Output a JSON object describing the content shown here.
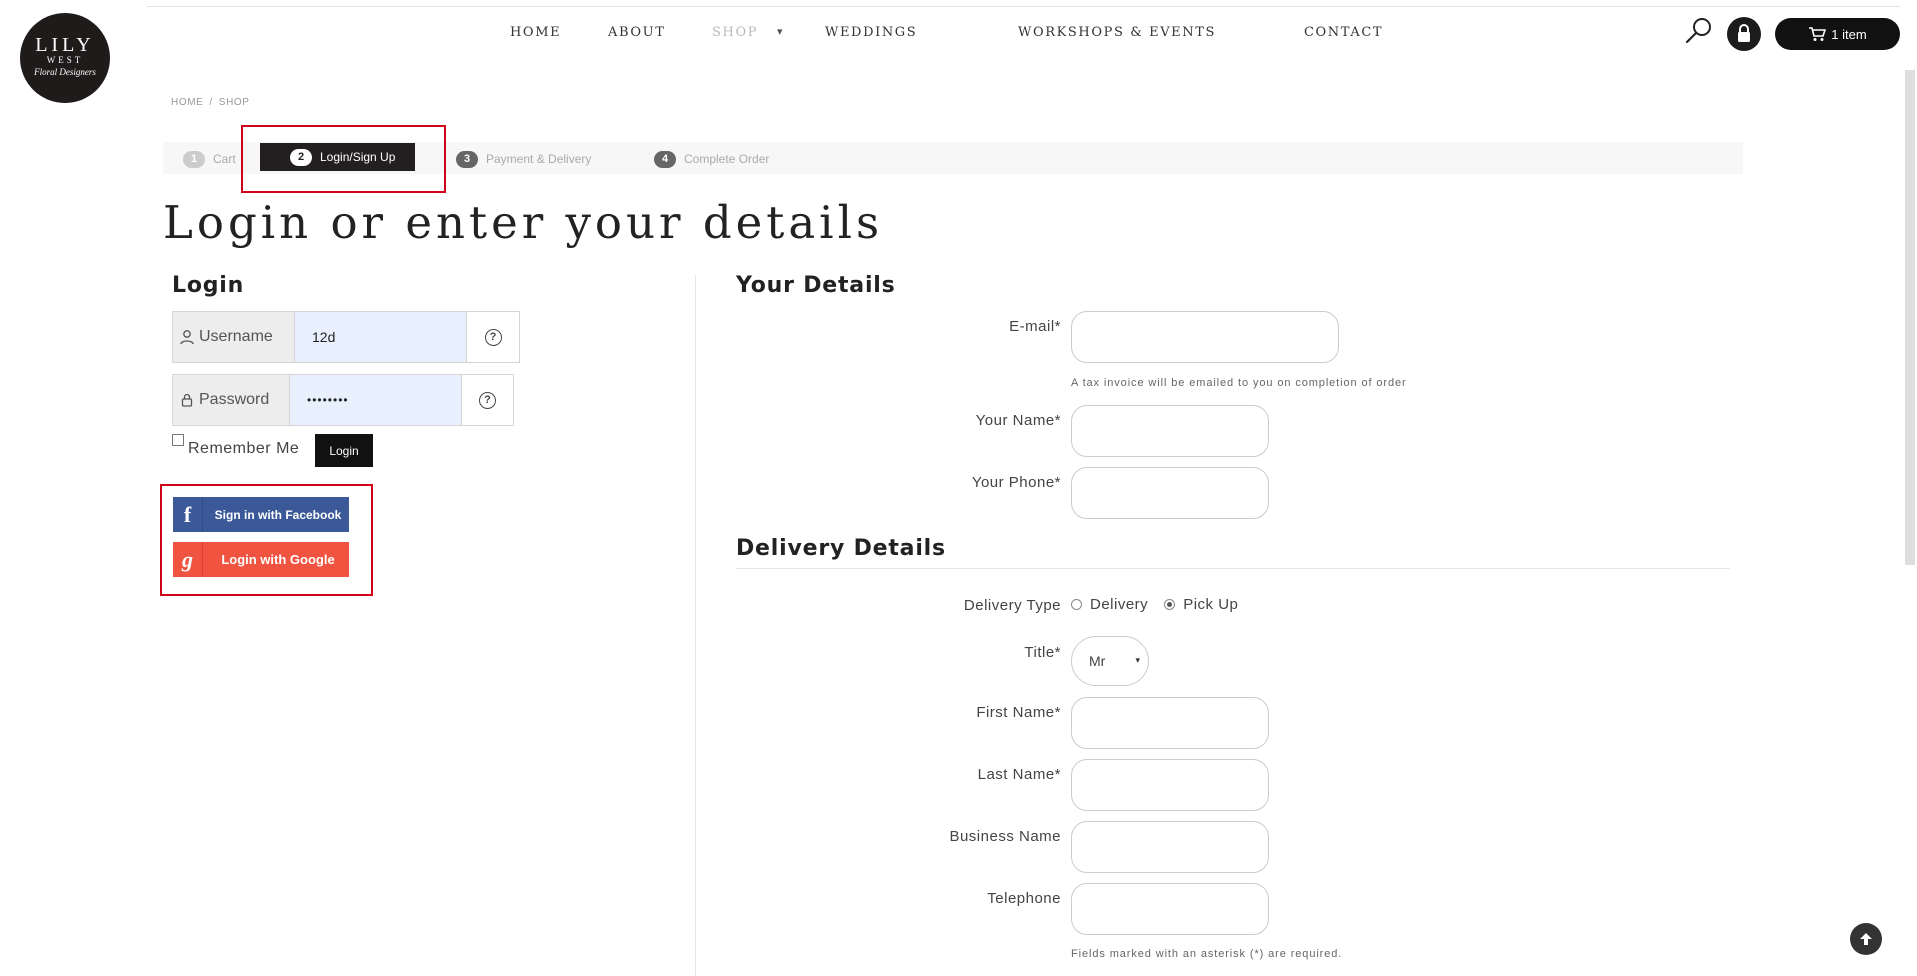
{
  "logo": {
    "name": "LILY",
    "sub": "WEST",
    "tagline": "Floral Designers"
  },
  "nav": {
    "items": [
      "HOME",
      "ABOUT",
      "SHOP",
      "WEDDINGS",
      "WORKSHOPS & EVENTS",
      "CONTACT"
    ],
    "caret": "▾"
  },
  "header": {
    "cart_label": "1 item"
  },
  "breadcrumb": [
    "HOME",
    "SHOP"
  ],
  "breadcrumb_sep": "/",
  "steps": [
    {
      "num": "1",
      "label": "Cart"
    },
    {
      "num": "2",
      "label": "Login/Sign Up"
    },
    {
      "num": "3",
      "label": "Payment & Delivery"
    },
    {
      "num": "4",
      "label": "Complete Order"
    }
  ],
  "page_title": "Login or enter your details",
  "login": {
    "title": "Login",
    "username_label": "Username",
    "username_value": "12d",
    "password_label": "Password",
    "password_value": "••••••••",
    "help_glyph": "?",
    "remember_label": "Remember Me",
    "login_button": "Login",
    "facebook_button": "Sign in with Facebook",
    "google_button": "Login with Google"
  },
  "your_details": {
    "title": "Your Details",
    "email_label": "E-mail*",
    "email_hint": "A tax invoice will be emailed to you on completion of order",
    "name_label": "Your Name*",
    "phone_label": "Your Phone*"
  },
  "delivery": {
    "title": "Delivery Details",
    "type_label": "Delivery Type",
    "options": [
      "Delivery",
      "Pick Up"
    ],
    "selected_option": "Pick Up",
    "title_label": "Title*",
    "title_value": "Mr",
    "first_name_label": "First Name*",
    "last_name_label": "Last Name*",
    "business_label": "Business Name",
    "telephone_label": "Telephone",
    "required_note": "Fields marked with an asterisk (*) are required."
  },
  "colors": {
    "accent": "#231f20",
    "highlight": "#d0021b",
    "facebook": "#3b5998",
    "google": "#f05340",
    "autofill": "#e8f0fe"
  }
}
